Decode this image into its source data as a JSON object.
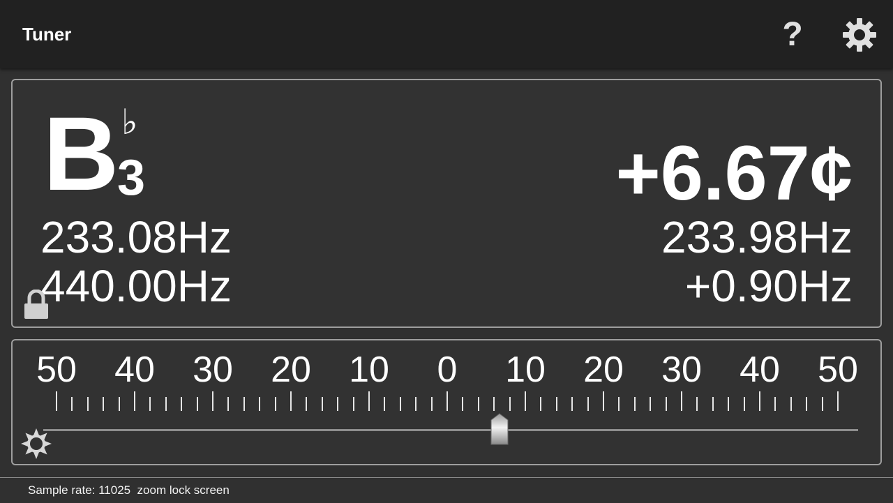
{
  "app": {
    "title": "Tuner"
  },
  "toolbar": {
    "help_label": "?",
    "help_icon": "question-mark-icon",
    "settings_icon": "gear-icon"
  },
  "note": {
    "letter": "B",
    "accidental": "♭",
    "octave": "3",
    "target_frequency": "233.08Hz",
    "reference_frequency": "440.00Hz",
    "lock_icon": "lock-icon"
  },
  "reading": {
    "cents": "+6.67¢",
    "detected_frequency": "233.98Hz",
    "offset_frequency": "+0.90Hz"
  },
  "meter": {
    "scale_labels": [
      "50",
      "40",
      "30",
      "20",
      "10",
      "0",
      "10",
      "20",
      "30",
      "40",
      "50"
    ],
    "range_cents": [
      -50,
      50
    ],
    "needle_cents": 6.67,
    "brightness_icon": "sun-icon"
  },
  "status": {
    "text": "Sample rate: 11025  zoom lock screen"
  },
  "colors": {
    "background": "#303030",
    "appbar": "#212121",
    "panel_border": "#9e9e9e",
    "text": "#ffffff"
  }
}
